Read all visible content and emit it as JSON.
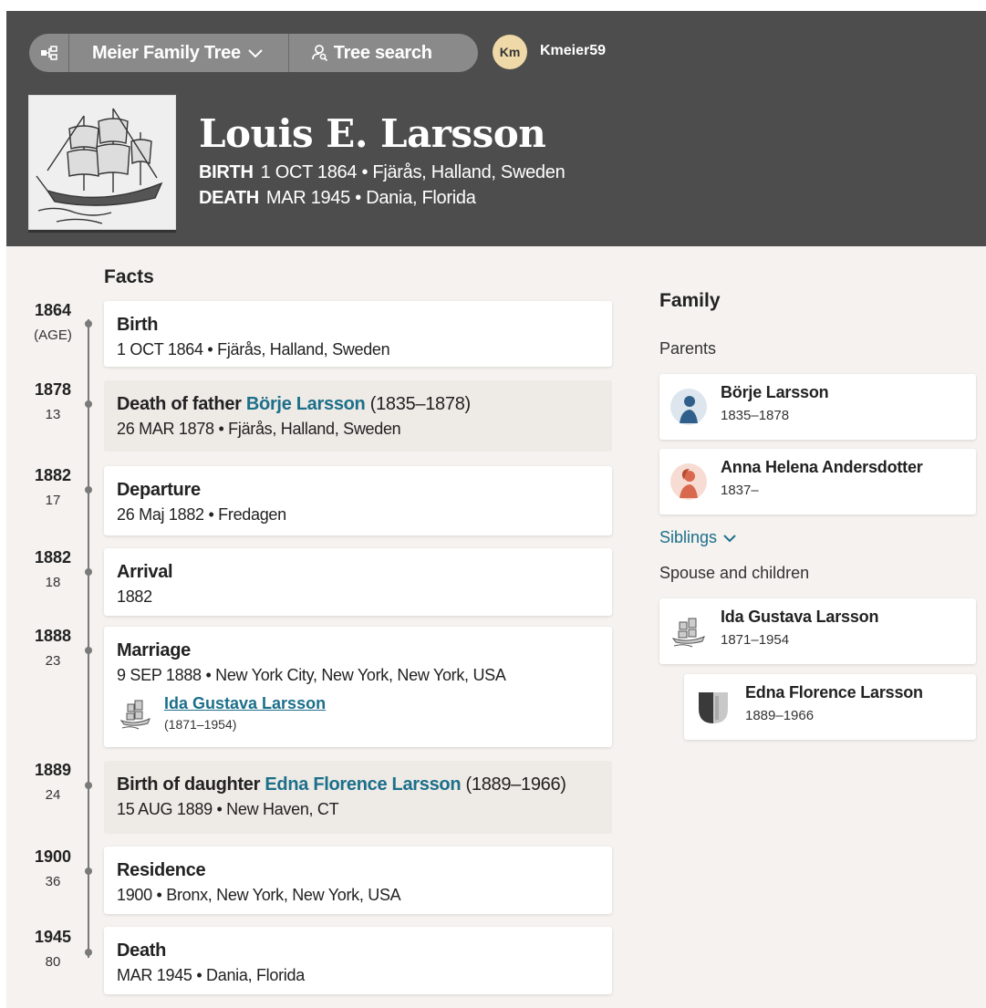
{
  "header": {
    "tree_name": "Meier Family Tree",
    "tree_search_label": "Tree search",
    "user_initials": "Km",
    "username": "Kmeier59",
    "person_name": "Louis E. Larsson",
    "birth_label": "BIRTH",
    "birth_value": "1 OCT 1864 • Fjärås, Halland, Sweden",
    "death_label": "DEATH",
    "death_value": "MAR 1945 • Dania, Florida"
  },
  "facts": {
    "title": "Facts",
    "timeline": [
      {
        "year": "1864",
        "age": "(AGE)"
      },
      {
        "year": "1878",
        "age": "13"
      },
      {
        "year": "1882",
        "age": "17"
      },
      {
        "year": "1882",
        "age": "18"
      },
      {
        "year": "1888",
        "age": "23"
      },
      {
        "year": "1889",
        "age": "24"
      },
      {
        "year": "1900",
        "age": "36"
      },
      {
        "year": "1945",
        "age": "80"
      }
    ],
    "birth": {
      "title": "Birth",
      "detail": "1 OCT 1864 • Fjärås, Halland, Sweden"
    },
    "death_father": {
      "prefix": "Death of father",
      "name": "Börje Larsson",
      "dates": "(1835–1878)",
      "detail": "26 MAR 1878 • Fjärås, Halland, Sweden"
    },
    "departure": {
      "title": "Departure",
      "detail": "26 Maj 1882 • Fredagen"
    },
    "arrival": {
      "title": "Arrival",
      "detail": "1882"
    },
    "marriage": {
      "title": "Marriage",
      "detail": "9 SEP 1888 • New York City, New York, New York, USA",
      "spouse_name": "Ida Gustava Larsson",
      "spouse_years": "(1871–1954)"
    },
    "birth_daughter": {
      "prefix": "Birth of daughter",
      "name": "Edna Florence Larsson",
      "dates": "(1889–1966)",
      "detail": "15 AUG 1889 • New Haven, CT"
    },
    "residence": {
      "title": "Residence",
      "detail": "1900 • Bronx, New York, New York, USA"
    },
    "death": {
      "title": "Death",
      "detail": "MAR 1945 • Dania, Florida"
    }
  },
  "family": {
    "title": "Family",
    "parents_label": "Parents",
    "parents": [
      {
        "name": "Börje Larsson",
        "years": "1835–1878"
      },
      {
        "name": "Anna Helena Andersdotter",
        "years": "1837–"
      }
    ],
    "siblings_label": "Siblings",
    "spouse_label": "Spouse and children",
    "spouse": {
      "name": "Ida Gustava Larsson",
      "years": "1871–1954"
    },
    "child": {
      "name": "Edna Florence Larsson",
      "years": "1889–1966"
    }
  },
  "colors": {
    "header_bg": "#4d4d4d",
    "link": "#1c6f8a",
    "page_bg": "#f5f2ef",
    "female_icon": "#d9694e",
    "male_icon": "#2f5f8a"
  }
}
